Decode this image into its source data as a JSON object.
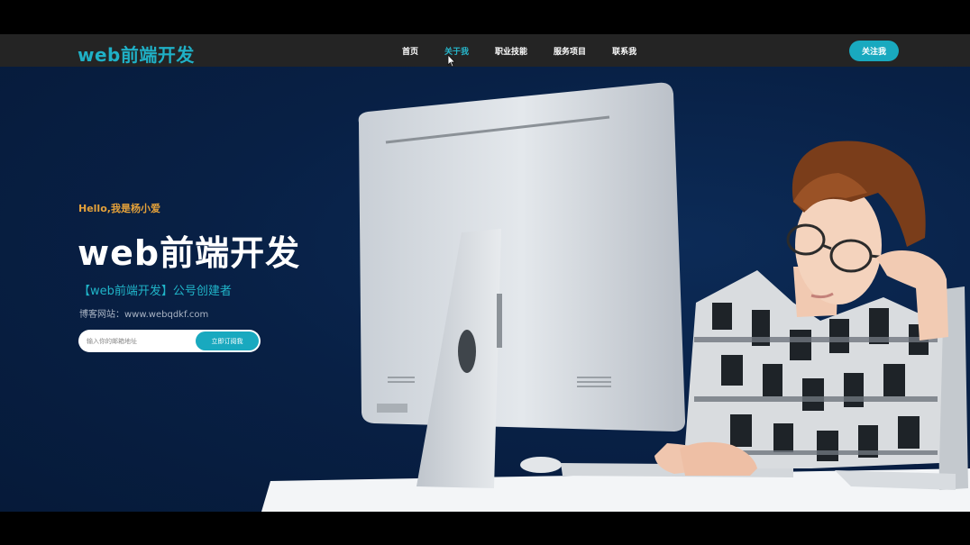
{
  "brand": {
    "logo": "web前端开发"
  },
  "nav": {
    "items": [
      "首页",
      "关于我",
      "职业技能",
      "服务项目",
      "联系我"
    ],
    "active_index": 1
  },
  "follow_label": "关注我",
  "hero": {
    "greeting": "Hello,我是杨小爱",
    "title": "web前端开发",
    "subtitle": "【web前端开发】公号创建者",
    "blog_line": "博客网站：www.webqdkf.com",
    "email_placeholder": "输入你的邮箱地址",
    "subscribe_label": "立即订阅我"
  },
  "colors": {
    "accent": "#19a9bf",
    "greeting": "#e4a13a",
    "hero_bg": "#081f41",
    "navbar_bg": "#242424"
  }
}
